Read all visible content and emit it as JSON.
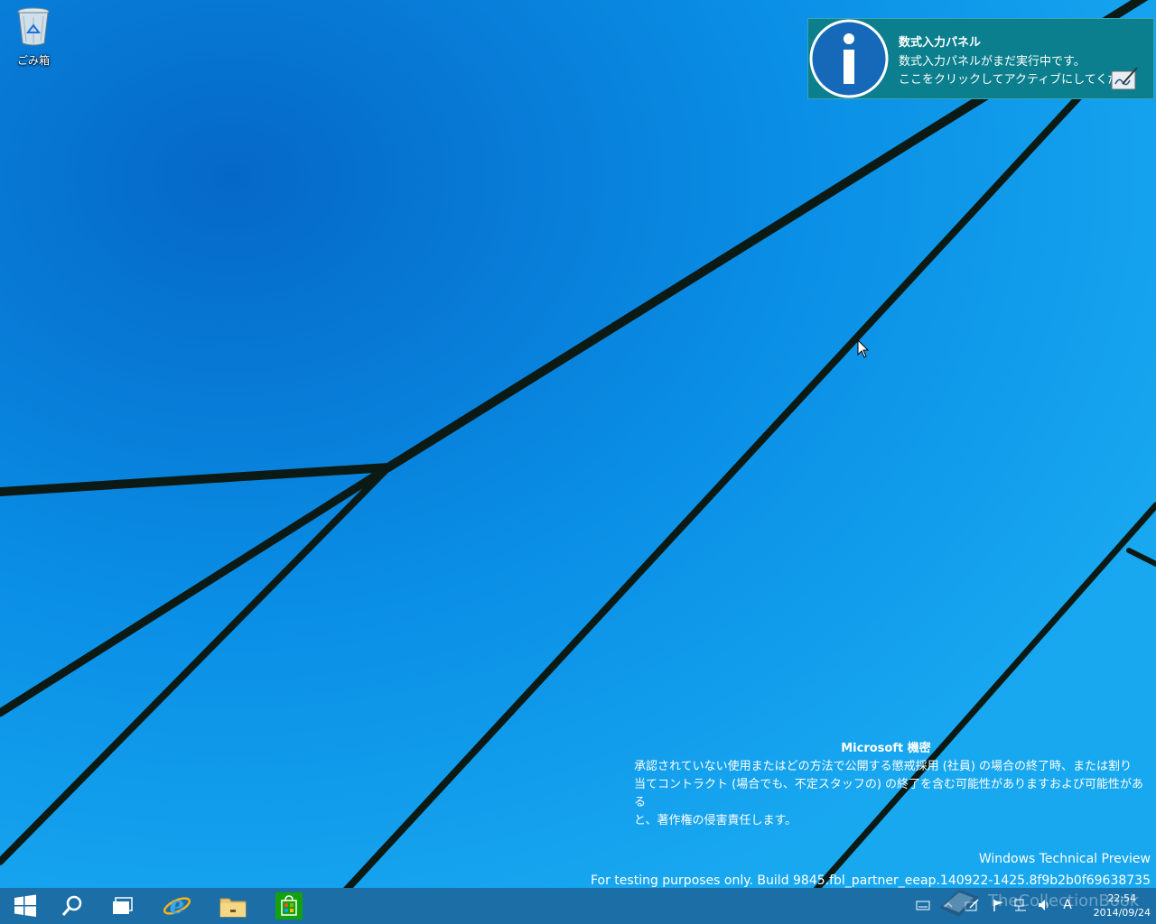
{
  "desktop": {
    "icons": [
      {
        "label": "ごみ箱",
        "icon": "recycle-bin-icon"
      }
    ]
  },
  "toast": {
    "title": "数式入力パネル",
    "line1": "数式入力パネルがまだ実行中です。",
    "line2": "ここをクリックしてアクティブにしてくだ…",
    "icon": "info-icon",
    "app_icon": "math-input-panel-icon",
    "color": "#0b7f8e"
  },
  "watermark": {
    "heading": "Microsoft 機密",
    "line1": "承認されていない使用またはどの方法で公開する懲戒採用 (社員) の場合の終了時、または割り",
    "line2": "当てコントラクト (場合でも、不定スタッフの) の終了を含む可能性がありますおよび可能性がある",
    "line3": "と、著作権の侵害責任します。"
  },
  "build": {
    "product": "Windows Technical Preview",
    "info": "For testing purposes only. Build 9845.fbl_partner_eeap.140922-1425.8f9b2b0f69638735"
  },
  "taskbar": {
    "buttons": [
      "start-icon",
      "search-icon",
      "task-view-icon",
      "internet-explorer-icon",
      "file-explorer-icon",
      "store-icon"
    ],
    "tray": {
      "ime_mode": "A",
      "time": "22:54",
      "date": "2014/09/24"
    }
  },
  "overlay": {
    "watermark_text": "TheCollectionBook"
  }
}
